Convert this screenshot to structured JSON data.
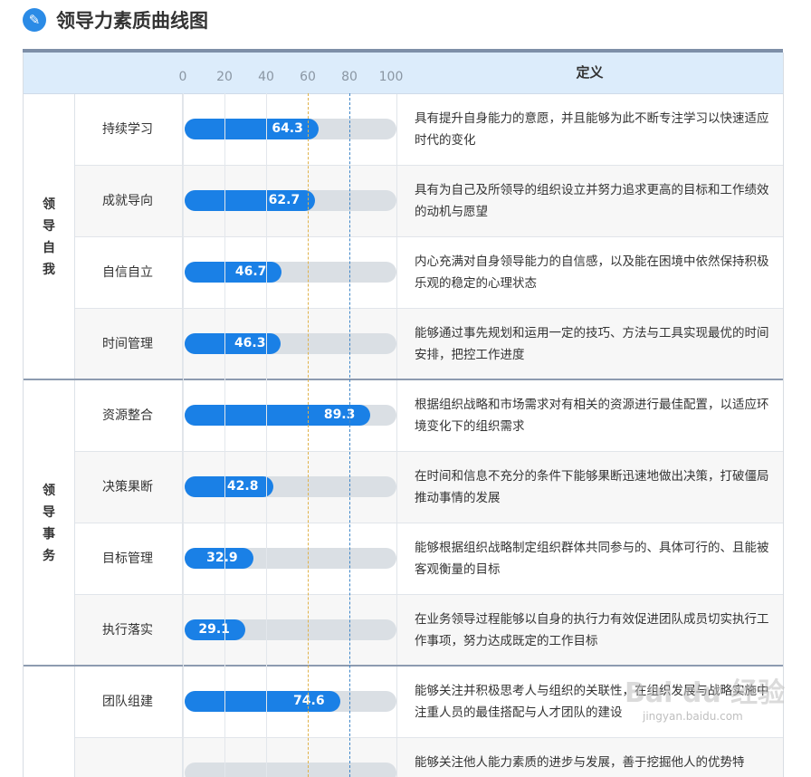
{
  "header": {
    "title": "领导力素质曲线图",
    "icon": "leaf-logo-icon",
    "icon_glyph": "✎"
  },
  "chart_data": {
    "type": "bar",
    "orientation": "horizontal",
    "title": "领导力素质曲线图",
    "axis_ticks": [
      "0",
      "20",
      "40",
      "60",
      "80",
      "100"
    ],
    "xlim": [
      0,
      100
    ],
    "reference_lines": [
      60,
      80
    ],
    "definition_header": "定义",
    "colors": {
      "bar": "#1a80e6",
      "track": "#dadfe4",
      "ref60": "#e0b24a",
      "ref80": "#3f86c8",
      "header_bg": "#dcecfb"
    },
    "groups": [
      {
        "name": "领导自我",
        "rows": [
          {
            "name": "持续学习",
            "value": 64.3,
            "label": "64.3",
            "definition": "具有提升自身能力的意愿，并且能够为此不断专注学习以快速适应时代的变化"
          },
          {
            "name": "成就导向",
            "value": 62.7,
            "label": "62.7",
            "definition": "具有为自己及所领导的组织设立并努力追求更高的目标和工作绩效的动机与愿望"
          },
          {
            "name": "自信自立",
            "value": 46.7,
            "label": "46.7",
            "definition": "内心充满对自身领导能力的自信感，以及能在困境中依然保持积极乐观的稳定的心理状态"
          },
          {
            "name": "时间管理",
            "value": 46.3,
            "label": "46.3",
            "definition": "能够通过事先规划和运用一定的技巧、方法与工具实现最优的时间安排，把控工作进度"
          }
        ]
      },
      {
        "name": "领导事务",
        "rows": [
          {
            "name": "资源整合",
            "value": 89.3,
            "label": "89.3",
            "definition": "根据组织战略和市场需求对有相关的资源进行最佳配置，以适应环境变化下的组织需求"
          },
          {
            "name": "决策果断",
            "value": 42.8,
            "label": "42.8",
            "definition": "在时间和信息不充分的条件下能够果断迅速地做出决策，打破僵局推动事情的发展"
          },
          {
            "name": "目标管理",
            "value": 32.9,
            "label": "32.9",
            "definition": "能够根据组织战略制定组织群体共同参与的、具体可行的、且能被客观衡量的目标"
          },
          {
            "name": "执行落实",
            "value": 29.1,
            "label": "29.1",
            "definition": "在业务领导过程能够以自身的执行力有效促进团队成员切实执行工作事项，努力达成既定的工作目标"
          }
        ]
      },
      {
        "name": "",
        "rows": [
          {
            "name": "团队组建",
            "value": 74.6,
            "label": "74.6",
            "definition": "能够关注并积极思考人与组织的关联性，在组织发展与战略实施中注重人员的最佳搭配与人才团队的建设"
          },
          {
            "name": "",
            "value": null,
            "label": "",
            "definition": "能够关注他人能力素质的进步与发展，善于挖掘他人的优势特"
          }
        ]
      }
    ]
  },
  "watermark": {
    "main": "Bai du 经验",
    "sub": "jingyan.baidu.com"
  }
}
